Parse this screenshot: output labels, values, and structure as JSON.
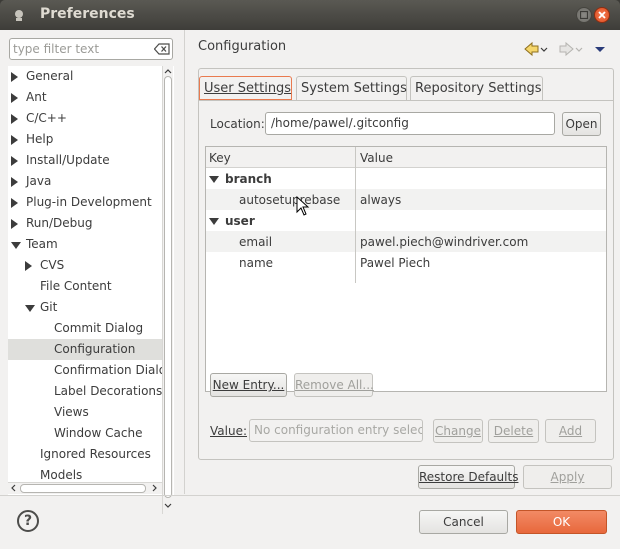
{
  "window": {
    "title": "Preferences"
  },
  "filter": {
    "placeholder": "type filter text"
  },
  "tree": [
    {
      "label": "General",
      "expander": "closed",
      "level": 0
    },
    {
      "label": "Ant",
      "expander": "closed",
      "level": 0
    },
    {
      "label": "C/C++",
      "expander": "closed",
      "level": 0
    },
    {
      "label": "Help",
      "expander": "closed",
      "level": 0
    },
    {
      "label": "Install/Update",
      "expander": "closed",
      "level": 0
    },
    {
      "label": "Java",
      "expander": "closed",
      "level": 0
    },
    {
      "label": "Plug-in Development",
      "expander": "closed",
      "level": 0
    },
    {
      "label": "Run/Debug",
      "expander": "closed",
      "level": 0
    },
    {
      "label": "Team",
      "expander": "open",
      "level": 0
    },
    {
      "label": "CVS",
      "expander": "closed",
      "level": 1
    },
    {
      "label": "File Content",
      "expander": "none",
      "level": 1
    },
    {
      "label": "Git",
      "expander": "open",
      "level": 1
    },
    {
      "label": "Commit Dialog",
      "expander": "none",
      "level": 2
    },
    {
      "label": "Configuration",
      "expander": "none",
      "level": 2,
      "selected": true
    },
    {
      "label": "Confirmation Dialogs",
      "expander": "none",
      "level": 2
    },
    {
      "label": "Label Decorations",
      "expander": "none",
      "level": 2
    },
    {
      "label": "Views",
      "expander": "none",
      "level": 2
    },
    {
      "label": "Window Cache",
      "expander": "none",
      "level": 2
    },
    {
      "label": "Ignored Resources",
      "expander": "none",
      "level": 1
    },
    {
      "label": "Models",
      "expander": "none",
      "level": 1
    }
  ],
  "page": {
    "title": "Configuration"
  },
  "tabs": [
    {
      "label": "User Settings",
      "active": true
    },
    {
      "label": "System Settings",
      "active": false
    },
    {
      "label": "Repository Settings",
      "active": false
    }
  ],
  "location": {
    "label": "Location:",
    "value": "/home/pawel/.gitconfig",
    "open_button": "Open"
  },
  "table": {
    "headers": {
      "key": "Key",
      "value": "Value"
    },
    "rows": [
      {
        "type": "section",
        "key": "branch",
        "value": ""
      },
      {
        "type": "entry",
        "key": "autosetuprebase",
        "value": "always"
      },
      {
        "type": "section",
        "key": "user",
        "value": ""
      },
      {
        "type": "entry",
        "key": "email",
        "value": "pawel.piech@windriver.com"
      },
      {
        "type": "entry",
        "key": "name",
        "value": "Pawel Piech"
      }
    ]
  },
  "actions": {
    "new_entry": "New Entry...",
    "remove_all": "Remove All...",
    "value_label": "Value:",
    "value_placeholder": "No configuration entry selected",
    "change": "Change",
    "delete": "Delete",
    "add": "Add",
    "restore_defaults": "Restore Defaults",
    "apply": "Apply",
    "cancel": "Cancel",
    "ok": "OK",
    "help": "?"
  },
  "colors": {
    "accent": "#e8683c",
    "title_bar": "#3e3d39",
    "selection": "#dfdfdc"
  }
}
